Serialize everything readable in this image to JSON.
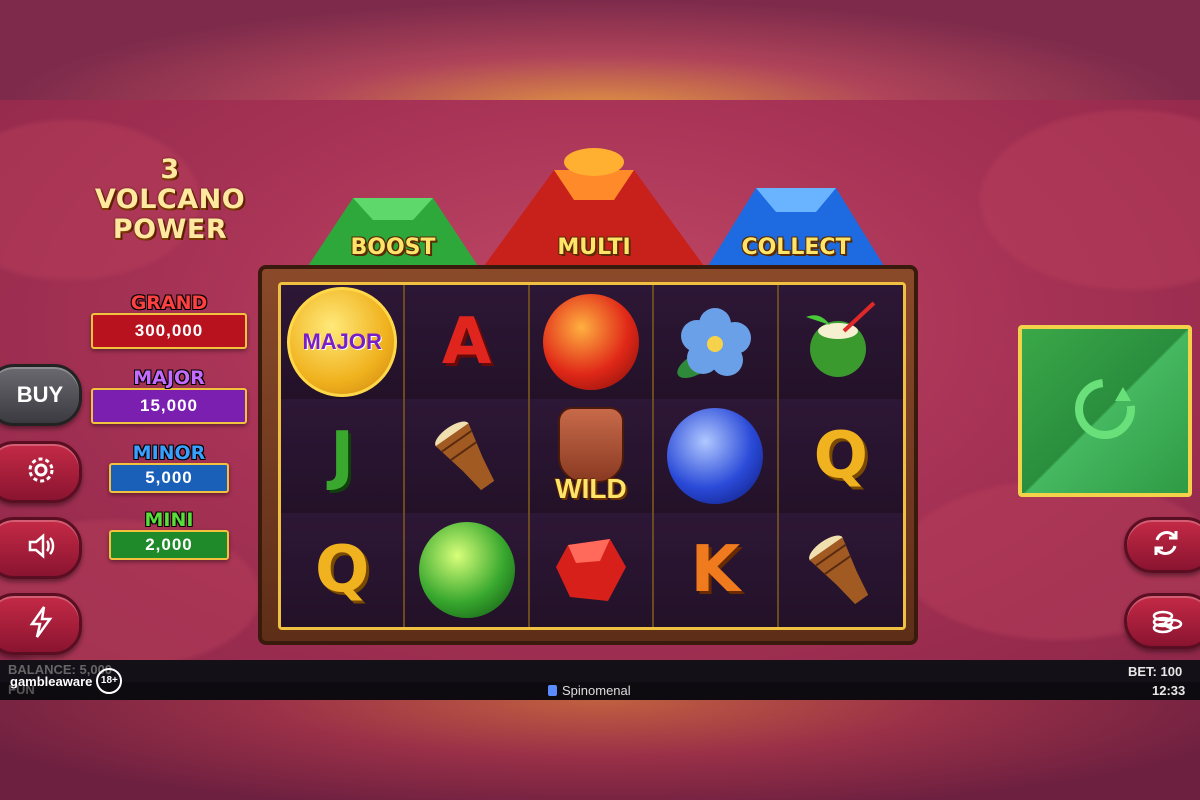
{
  "game": {
    "title_line1": "3",
    "title_line2": "VOLCANO",
    "title_line3": "POWER"
  },
  "jackpots": [
    {
      "label": "GRAND",
      "value": "300,000",
      "label_color": "#ff3b3b",
      "box_color": "#b8121e"
    },
    {
      "label": "MAJOR",
      "value": "15,000",
      "label_color": "#b35cff",
      "box_color": "#7a1fb0"
    },
    {
      "label": "MINOR",
      "value": "5,000",
      "label_color": "#3aa0ff",
      "box_color": "#1a5fb8"
    },
    {
      "label": "MINI",
      "value": "2,000",
      "label_color": "#5adc3a",
      "box_color": "#1f8a2a"
    }
  ],
  "left_buttons": {
    "buy_label": "BUY",
    "settings_icon": "gear-icon",
    "sound_icon": "speaker-icon",
    "turbo_icon": "lightning-icon"
  },
  "volcanoes": [
    {
      "label": "BOOST",
      "color": "#2ea83a"
    },
    {
      "label": "MULTI",
      "color": "#e0301e"
    },
    {
      "label": "COLLECT",
      "color": "#1e6ae0"
    }
  ],
  "reels": {
    "symbols": [
      [
        "coin-major",
        "letter-A",
        "orb-red",
        "hibiscus",
        "coconut"
      ],
      [
        "letter-J",
        "drum",
        "wild",
        "orb-blue",
        "letter-Q"
      ],
      [
        "letter-Q",
        "orb-green",
        "ruby",
        "letter-K",
        "drum"
      ]
    ],
    "coin_label": "MAJOR",
    "wild_label": "WILD",
    "letters": {
      "A": "A",
      "J": "J",
      "Q": "Q",
      "K": "K"
    }
  },
  "right_buttons": {
    "spin_icon": "spin-icon",
    "autoplay_icon": "autoplay-icon",
    "bet_icon": "coins-icon"
  },
  "status_bar": {
    "balance_label": "BALANCE: 5,000",
    "mode": "FUN",
    "gambleaware": "gambleaware",
    "age": "18+",
    "provider": "Spinomenal",
    "bet": "BET: 100",
    "clock": "12:33"
  }
}
